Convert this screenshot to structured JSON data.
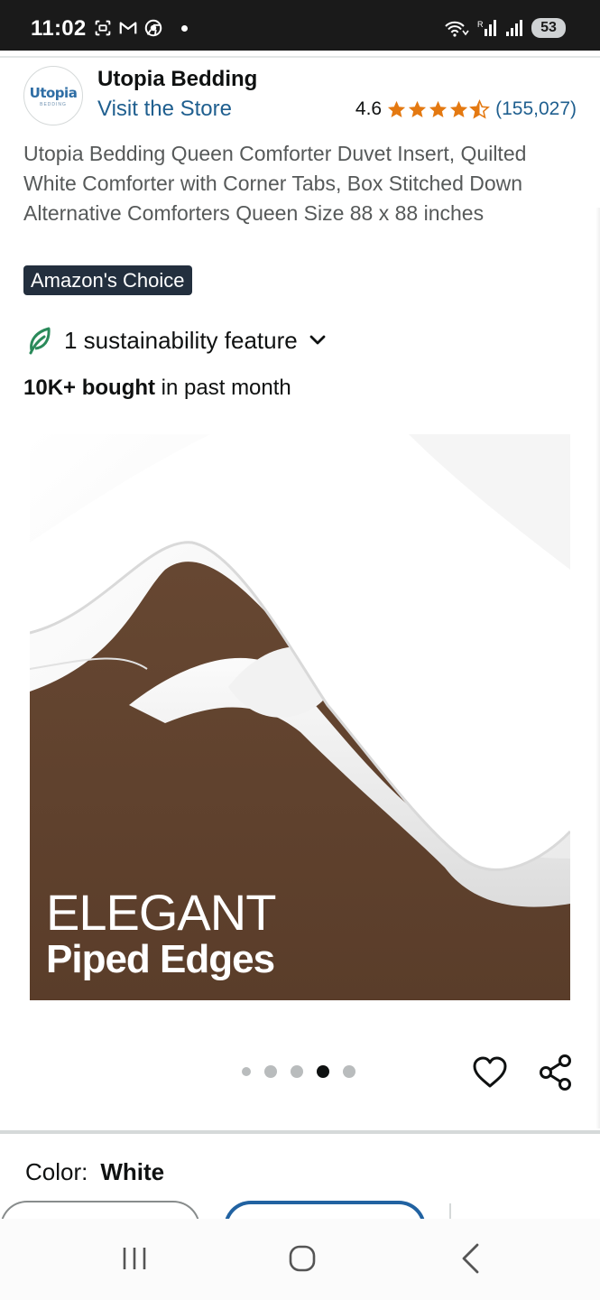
{
  "status_bar": {
    "time": "11:02",
    "battery": "53",
    "left_icons": [
      "screenshot-icon",
      "gmail-icon",
      "chrome-icon"
    ],
    "right_icons": [
      "wifi-calling-icon",
      "signal-icon",
      "signal-icon-2"
    ]
  },
  "store": {
    "logo_word": "Utopia",
    "logo_sub": "BEDDING",
    "name": "Utopia Bedding",
    "visit_link": "Visit the Store",
    "rating": "4.6",
    "rating_count": "(155,027)",
    "stars_filled": 4.5
  },
  "product": {
    "title": "Utopia Bedding Queen Comforter Duvet Insert, Quilted White Comforter with Corner Tabs, Box Stitched Down Alternative Comforters Queen Size 88 x 88 inches",
    "badge": "Amazon's Choice",
    "sustainability": "1 sustainability feature",
    "bought_bold": "10K+ bought",
    "bought_rest": " in past month"
  },
  "image": {
    "caption_line1": "ELEGANT",
    "caption_line2": "Piped Edges",
    "carousel_total": 5,
    "carousel_active": 4
  },
  "variation": {
    "label": "Color:",
    "value": "White"
  },
  "colors": {
    "link": "#1f5f8f",
    "star": "#e47911",
    "badge_bg": "#232f3e",
    "selected_border": "#2162a1"
  }
}
